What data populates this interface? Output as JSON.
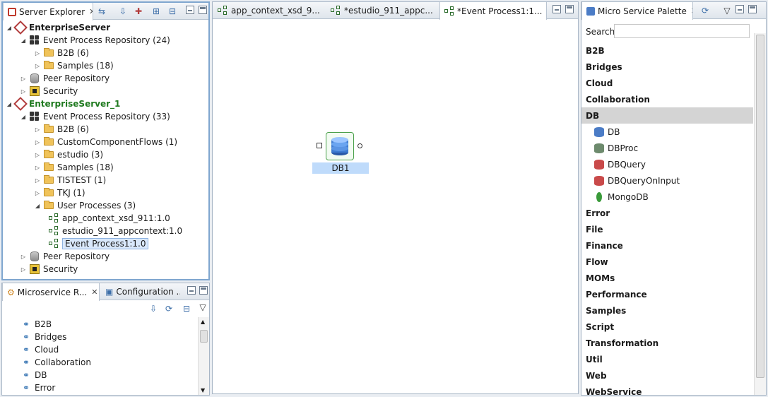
{
  "server_explorer": {
    "tab_label": "Server Explorer",
    "tree": [
      {
        "label": "EnterpriseServer",
        "level": 0,
        "type": "server",
        "bold": true
      },
      {
        "label": "Event Process Repository (24)",
        "level": 1,
        "type": "repo"
      },
      {
        "label": "B2B (6)",
        "level": 2,
        "type": "folder"
      },
      {
        "label": "Samples (18)",
        "level": 2,
        "type": "folder"
      },
      {
        "label": "Peer Repository",
        "level": 1,
        "type": "peer"
      },
      {
        "label": "Security",
        "level": 1,
        "type": "lock"
      },
      {
        "label": "EnterpriseServer_1",
        "level": 0,
        "type": "server",
        "bold": true,
        "green": true
      },
      {
        "label": "Event Process Repository (33)",
        "level": 1,
        "type": "repo"
      },
      {
        "label": "B2B (6)",
        "level": 2,
        "type": "folder"
      },
      {
        "label": "CustomComponentFlows (1)",
        "level": 2,
        "type": "folder"
      },
      {
        "label": "estudio (3)",
        "level": 2,
        "type": "folder"
      },
      {
        "label": "Samples (18)",
        "level": 2,
        "type": "folder"
      },
      {
        "label": "TISTEST (1)",
        "level": 2,
        "type": "folder"
      },
      {
        "label": "TKJ (1)",
        "level": 2,
        "type": "folder"
      },
      {
        "label": "User Processes (3)",
        "level": 2,
        "type": "folder"
      },
      {
        "label": "app_context_xsd_911:1.0",
        "level": 3,
        "type": "flow"
      },
      {
        "label": "estudio_911_appcontext:1.0",
        "level": 3,
        "type": "flow"
      },
      {
        "label": "Event Process1:1.0",
        "level": 3,
        "type": "flow",
        "selected": true
      },
      {
        "label": "Peer Repository",
        "level": 1,
        "type": "peer"
      },
      {
        "label": "Security",
        "level": 1,
        "type": "lock"
      }
    ]
  },
  "microservice_panel": {
    "tabs": [
      "Microservice R...",
      "Configuration ..."
    ],
    "items": [
      "B2B",
      "Bridges",
      "Cloud",
      "Collaboration",
      "DB",
      "Error"
    ]
  },
  "editor": {
    "tabs": [
      "app_context_xsd_9...",
      "*estudio_911_appc...",
      "*Event Process1:1..."
    ],
    "node_label": "DB1"
  },
  "palette": {
    "tab_label": "Micro Service Palette",
    "search_label": "Search",
    "search_value": "",
    "categories_top": [
      "B2B",
      "Bridges",
      "Cloud",
      "Collaboration",
      "DB"
    ],
    "db_items": [
      "DB",
      "DBProc",
      "DBQuery",
      "DBQueryOnInput",
      "MongoDB"
    ],
    "categories_bottom": [
      "Error",
      "File",
      "Finance",
      "Flow",
      "MOMs",
      "Performance",
      "Samples",
      "Script",
      "Transformation",
      "Util",
      "Web",
      "WebService"
    ]
  }
}
